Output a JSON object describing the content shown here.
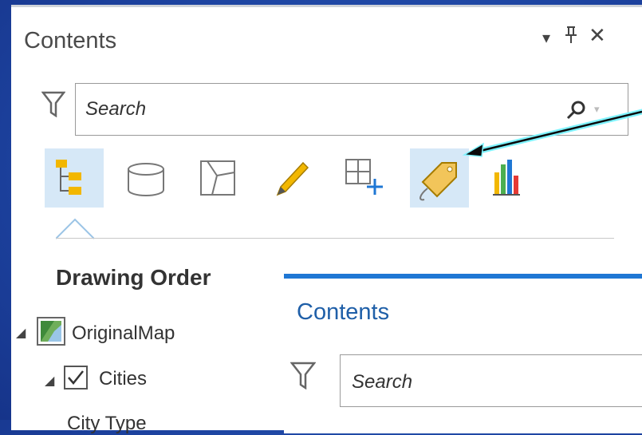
{
  "panel": {
    "title": "Contents",
    "pin_glyph": "▾ ⫯ ✕",
    "search_placeholder": "Search",
    "tabs": [
      {
        "name": "list-by-drawing-order",
        "icon": "drawing-order-icon",
        "selected": true
      },
      {
        "name": "list-by-source",
        "icon": "data-source-icon",
        "selected": false
      },
      {
        "name": "list-by-selection",
        "icon": "selection-icon",
        "selected": false
      },
      {
        "name": "list-by-editing",
        "icon": "pencil-icon",
        "selected": false
      },
      {
        "name": "list-by-snapping",
        "icon": "snapping-icon",
        "selected": false
      },
      {
        "name": "list-by-labeling",
        "icon": "label-tag-icon",
        "selected": false,
        "highlighted": true
      },
      {
        "name": "list-by-charts",
        "icon": "bar-chart-icon",
        "selected": false
      }
    ],
    "section_heading": "Drawing Order",
    "tree": {
      "map_name": "OriginalMap",
      "layer_name": "Cities",
      "layer_checked": true,
      "sublabel": "City Type"
    }
  },
  "overlay_panel": {
    "title": "Contents",
    "search_placeholder": "Search"
  },
  "colors": {
    "background": "#1d43a0",
    "accent": "#1f77d4",
    "selected_tab": "#d6e8f7",
    "callout": "#7ff3ff"
  }
}
